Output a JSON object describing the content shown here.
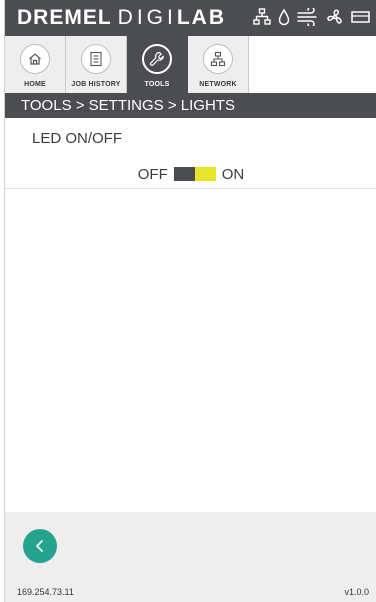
{
  "brand": {
    "part1": "DREMEL",
    "part2": "DIGI",
    "part3": "LAB"
  },
  "status_icons": [
    "network-icon",
    "humidity-icon",
    "airflow-icon",
    "fan-icon",
    "battery-icon"
  ],
  "tabs": [
    {
      "label": "HOME",
      "icon": "home-icon"
    },
    {
      "label": "JOB HISTORY",
      "icon": "document-icon"
    },
    {
      "label": "TOOLS",
      "icon": "wrench-icon"
    },
    {
      "label": "NETWORK",
      "icon": "network-icon"
    }
  ],
  "active_tab": "TOOLS",
  "breadcrumb": "TOOLS > SETTINGS > LIGHTS",
  "setting": {
    "title": "LED ON/OFF",
    "off_label": "OFF",
    "on_label": "ON",
    "state": "ON"
  },
  "footer": {
    "ip": "169.254.73.11",
    "version": "v1.0.0"
  },
  "colors": {
    "header": "#4b4d50",
    "accent": "#24a38e",
    "toggle_on": "#e5e52a",
    "footer_bg": "#eeeeee"
  }
}
